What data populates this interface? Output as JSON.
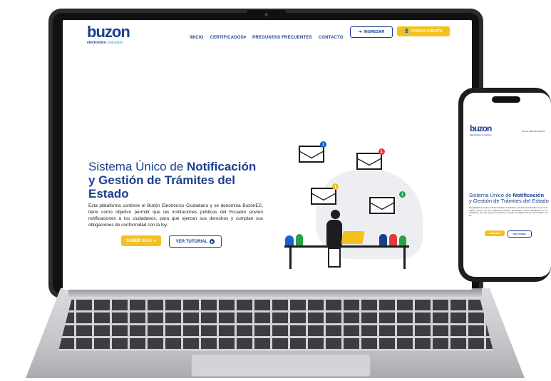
{
  "site": {
    "logo_main": "buzon",
    "logo_sub_bold": "electrónico",
    "logo_sub": "ciudadano"
  },
  "nav": {
    "items": [
      "INICIO",
      "CERTIFICADOS",
      "PREGUNTAS FRECUENTES",
      "CONTACTO"
    ],
    "login_label": "INGRESAR",
    "signup_label": "CREAR CUENTA"
  },
  "hero": {
    "title_part1": "Sistema Único de ",
    "title_bold": "Notificación",
    "title_line2": "y Gestión de Trámites del Estado",
    "description": "Esta plataforma contiene el Buzón Electrónico Ciudadano y se denomina BuzónEC, tiene como objetivo permitir que las instituciones públicas del Ecuador envíen notificaciones a los ciudadanos, para que ejerzan sus derechos y cumplan sus obligaciones de conformidad con la ley.",
    "primary_button": "SABER MÁS",
    "secondary_button": "VER TUTORIAL"
  },
  "notifications": [
    {
      "color": "#1b5fc9",
      "label": "1"
    },
    {
      "color": "#e23b3b",
      "label": "1"
    },
    {
      "color": "#f4c020",
      "label": "1"
    },
    {
      "color": "#29a34a",
      "label": "1"
    }
  ],
  "colors": {
    "brand_blue": "#1b3f8f",
    "accent_cyan": "#0aa6d6",
    "accent_yellow": "#f4c020"
  }
}
